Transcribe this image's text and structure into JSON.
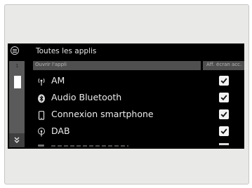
{
  "header": {
    "title": "Toutes les applis"
  },
  "columns": {
    "app": "Ouvrir l'appli",
    "display": "Aff. écran acc."
  },
  "scroll": {
    "page": "1"
  },
  "rows": [
    {
      "label": "AM",
      "icon": "radio-antenna-icon",
      "checked": true
    },
    {
      "label": "Audio Bluetooth",
      "icon": "bluetooth-icon",
      "checked": true
    },
    {
      "label": "Connexion smartphone",
      "icon": "smartphone-icon",
      "checked": true
    },
    {
      "label": "DAB",
      "icon": "radio-antenna-icon",
      "checked": true
    }
  ]
}
